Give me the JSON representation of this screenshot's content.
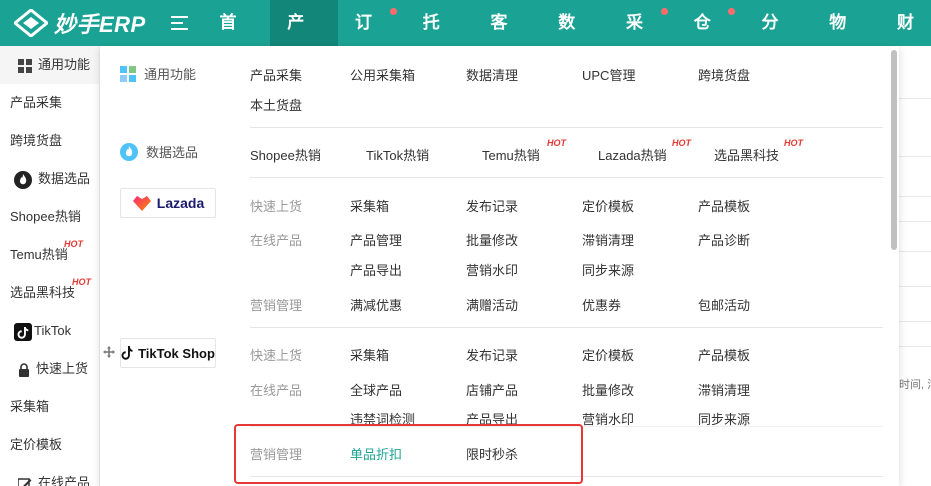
{
  "brand": {
    "logo_text": "妙手ERP"
  },
  "nav": {
    "items": [
      {
        "label": "首页",
        "active": false,
        "dot": false
      },
      {
        "label": "产品",
        "active": true,
        "dot": false
      },
      {
        "label": "订单",
        "active": false,
        "dot": true
      },
      {
        "label": "托管",
        "active": false,
        "dot": false
      },
      {
        "label": "客服",
        "active": false,
        "dot": false
      },
      {
        "label": "数据",
        "active": false,
        "dot": false
      },
      {
        "label": "采购",
        "active": false,
        "dot": true
      },
      {
        "label": "仓库",
        "active": false,
        "dot": true
      },
      {
        "label": "分销",
        "active": false,
        "dot": false
      },
      {
        "label": "物流",
        "active": false,
        "dot": false
      },
      {
        "label": "财",
        "active": false,
        "dot": false
      }
    ]
  },
  "sidebar": {
    "items": [
      {
        "label": "通用功能"
      },
      {
        "label": "产品采集"
      },
      {
        "label": "跨境货盘"
      },
      {
        "label": "数据选品"
      },
      {
        "label": "Shopee热销"
      },
      {
        "label": "Temu热销",
        "badge": "HOT"
      },
      {
        "label": "选品黑科技",
        "badge": "HOT"
      },
      {
        "label": "TikTok"
      },
      {
        "label": "快速上货"
      },
      {
        "label": "采集箱"
      },
      {
        "label": "定价模板"
      },
      {
        "label": "在线产品"
      }
    ]
  },
  "dropdown": {
    "general": {
      "title": "通用功能",
      "links": [
        "产品采集",
        "公用采集箱",
        "数据清理",
        "UPC管理",
        "跨境货盘",
        "本土货盘"
      ]
    },
    "data_selection": {
      "title": "数据选品",
      "links": [
        {
          "label": "Shopee热销"
        },
        {
          "label": "TikTok热销"
        },
        {
          "label": "Temu热销",
          "badge": "HOT"
        },
        {
          "label": "Lazada热销",
          "badge": "HOT"
        },
        {
          "label": "选品黑科技",
          "badge": "HOT"
        }
      ]
    },
    "lazada": {
      "brand": "Lazada",
      "quick_label": "快速上货",
      "quick_links": [
        "采集箱",
        "发布记录",
        "定价模板",
        "产品模板"
      ],
      "online_label": "在线产品",
      "online_links": [
        "产品管理",
        "批量修改",
        "滞销清理",
        "产品诊断",
        "产品导出",
        "营销水印",
        "同步来源"
      ],
      "marketing_label": "营销管理",
      "marketing_links": [
        "满减优惠",
        "满赠活动",
        "优惠券",
        "包邮活动"
      ]
    },
    "tiktok": {
      "brand": "TikTok Shop",
      "quick_label": "快速上货",
      "quick_links": [
        "采集箱",
        "发布记录",
        "定价模板",
        "产品模板"
      ],
      "online_label": "在线产品",
      "online_links": [
        "全球产品",
        "店铺产品",
        "批量修改",
        "滞销清理",
        "违禁词检测",
        "产品导出",
        "营销水印",
        "同步来源"
      ],
      "marketing_label": "营销管理",
      "marketing_links": [
        "单品折扣",
        "限时秒杀"
      ]
    }
  },
  "right_bg": {
    "text": "时间, 活"
  },
  "colors": {
    "primary": "#1aa394",
    "active_nav": "#13867a",
    "hot": "#e53935",
    "highlight_box": "#e53935"
  }
}
